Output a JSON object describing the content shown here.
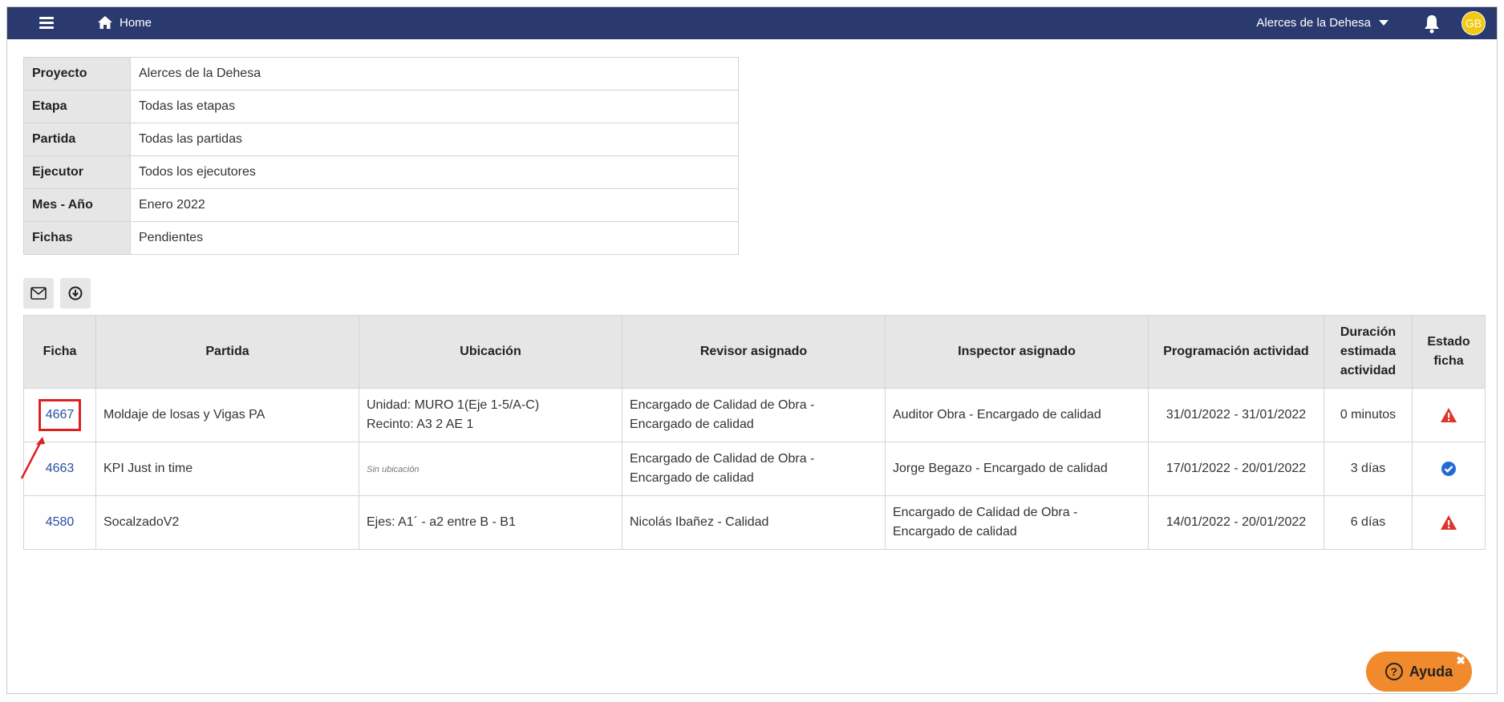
{
  "topbar": {
    "menu_icon": "hamburger-icon",
    "home_icon": "home-icon",
    "home_label": "Home",
    "project_selected": "Alerces de la Dehesa",
    "bell_icon": "bell-icon",
    "avatar_initials": "GB",
    "bar_color": "#2b3a6e",
    "avatar_color": "#f2c811"
  },
  "filters": [
    {
      "label": "Proyecto",
      "value": "Alerces de la Dehesa"
    },
    {
      "label": "Etapa",
      "value": "Todas las etapas"
    },
    {
      "label": "Partida",
      "value": "Todas las partidas"
    },
    {
      "label": "Ejecutor",
      "value": "Todos los ejecutores"
    },
    {
      "label": "Mes - Año",
      "value": "Enero 2022"
    },
    {
      "label": "Fichas",
      "value": "Pendientes"
    }
  ],
  "tools": {
    "email_icon": "envelope-icon",
    "download_icon": "download-icon"
  },
  "table": {
    "headers": {
      "ficha": "Ficha",
      "partida": "Partida",
      "ubicacion": "Ubicación",
      "revisor": "Revisor asignado",
      "inspector": "Inspector asignado",
      "programacion": "Programación actividad",
      "duracion": "Duración estimada actividad",
      "estado": "Estado ficha"
    },
    "rows": [
      {
        "ficha": "4667",
        "partida": "Moldaje de losas y Vigas PA",
        "ubicacion_line1": "Unidad: MURO 1(Eje 1-5/A-C)",
        "ubicacion_line2": "Recinto: A3 2 AE 1",
        "revisor": "Encargado de Calidad de Obra - Encargado de calidad",
        "inspector": "Auditor Obra - Encargado de calidad",
        "programacion": "31/01/2022 - 31/01/2022",
        "duracion": "0 minutos",
        "estado_icon": "warning-triangle-icon"
      },
      {
        "ficha": "4663",
        "partida": "KPI Just in time",
        "ubicacion_line1": "Sin ubicación",
        "ubicacion_line2": "",
        "revisor": "Encargado de Calidad de Obra - Encargado de calidad",
        "inspector": "Jorge Begazo - Encargado de calidad",
        "programacion": "17/01/2022 - 20/01/2022",
        "duracion": "3 días",
        "estado_icon": "check-circle-icon"
      },
      {
        "ficha": "4580",
        "partida": "SocalzadoV2",
        "ubicacion_line1": "Ejes: A1´ - a2 entre B - B1",
        "ubicacion_line2": "",
        "revisor": "Nicolás Ibañez - Calidad",
        "inspector": "Encargado de Calidad de Obra - Encargado de calidad",
        "programacion": "14/01/2022 - 20/01/2022",
        "duracion": "6 días",
        "estado_icon": "warning-triangle-icon"
      }
    ]
  },
  "help": {
    "label": "Ayuda",
    "icon": "question-circle-icon",
    "close": "✖",
    "color": "#f08a2c"
  },
  "annotation": {
    "highlight_color": "#e02020"
  }
}
